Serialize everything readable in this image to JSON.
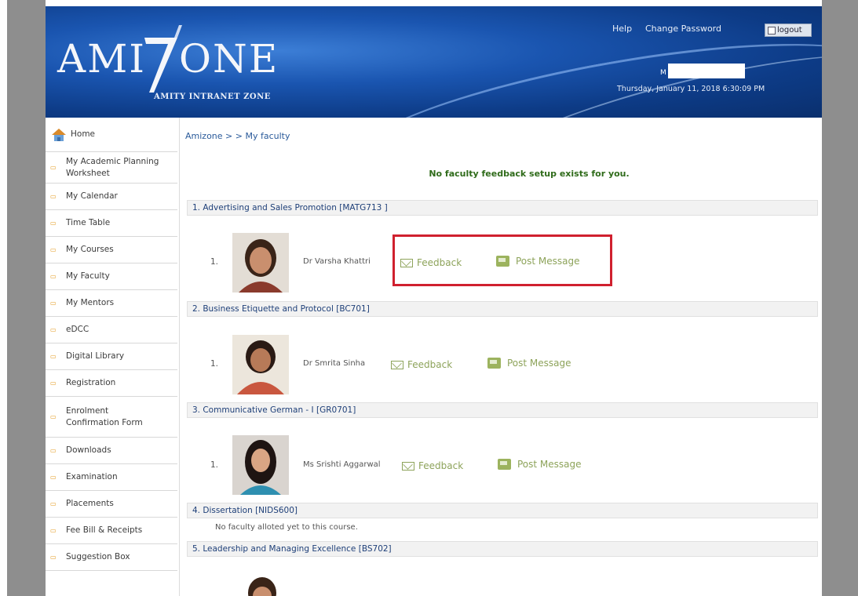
{
  "header": {
    "logo_main": "AMI",
    "logo_end": "ONE",
    "logo_sub": "AMITY INTRANET ZONE",
    "help": "Help",
    "change_password": "Change Password",
    "logout": "logout",
    "user_prefix": "M",
    "datetime": "Thursday, January 11, 2018 6:30:09 PM"
  },
  "sidebar": {
    "items": [
      {
        "label": "Home",
        "lines": [
          "Home"
        ]
      },
      {
        "label": "My Academic Planning Worksheet",
        "lines": [
          "My Academic Planning",
          "Worksheet"
        ]
      },
      {
        "label": "My Calendar",
        "lines": [
          "My Calendar"
        ]
      },
      {
        "label": "Time Table",
        "lines": [
          "Time Table"
        ]
      },
      {
        "label": "My Courses",
        "lines": [
          "My Courses"
        ]
      },
      {
        "label": "My Faculty",
        "lines": [
          "My Faculty"
        ]
      },
      {
        "label": "My Mentors",
        "lines": [
          "My Mentors"
        ]
      },
      {
        "label": "eDCC",
        "lines": [
          "eDCC"
        ]
      },
      {
        "label": "Digital Library",
        "lines": [
          "Digital Library"
        ]
      },
      {
        "label": "Registration",
        "lines": [
          "Registration"
        ]
      },
      {
        "label": "Enrolment Confirmation Form",
        "lines": [
          "Enrolment",
          "Confirmation Form"
        ]
      },
      {
        "label": "Downloads",
        "lines": [
          "Downloads"
        ]
      },
      {
        "label": "Examination",
        "lines": [
          "Examination"
        ]
      },
      {
        "label": "Placements",
        "lines": [
          "Placements"
        ]
      },
      {
        "label": "Fee Bill & Receipts",
        "lines": [
          "Fee Bill & Receipts"
        ]
      },
      {
        "label": "Suggestion Box",
        "lines": [
          "Suggestion Box"
        ]
      }
    ]
  },
  "main": {
    "breadcrumb": "Amizone > > My faculty",
    "notice": "No faculty feedback setup exists for you.",
    "courses": [
      {
        "title": "1. Advertising and Sales Promotion [MATG713 ]",
        "faculty": [
          {
            "sno": "1.",
            "name": "Dr Varsha Khattri"
          }
        ]
      },
      {
        "title": "2. Business Etiquette and Protocol [BC701]",
        "faculty": [
          {
            "sno": "1.",
            "name": "Dr Smrita Sinha"
          }
        ]
      },
      {
        "title": "3. Communicative German - I [GR0701]",
        "faculty": [
          {
            "sno": "1.",
            "name": "Ms Srishti Aggarwal"
          }
        ]
      },
      {
        "title": "4. Dissertation [NIDS600]",
        "faculty": [],
        "no_faculty": "No faculty alloted yet to this course."
      },
      {
        "title": "5. Leadership and Managing Excellence [BS702]",
        "faculty": []
      }
    ],
    "feedback_label": "Feedback",
    "post_message_label": "Post Message"
  },
  "colors": {
    "header_blue": "#1a55b0",
    "link_green": "#8da35a",
    "notice_green": "#2f6b1a",
    "highlight_red": "#d0202e",
    "bullet_orange": "#e39a1c"
  }
}
